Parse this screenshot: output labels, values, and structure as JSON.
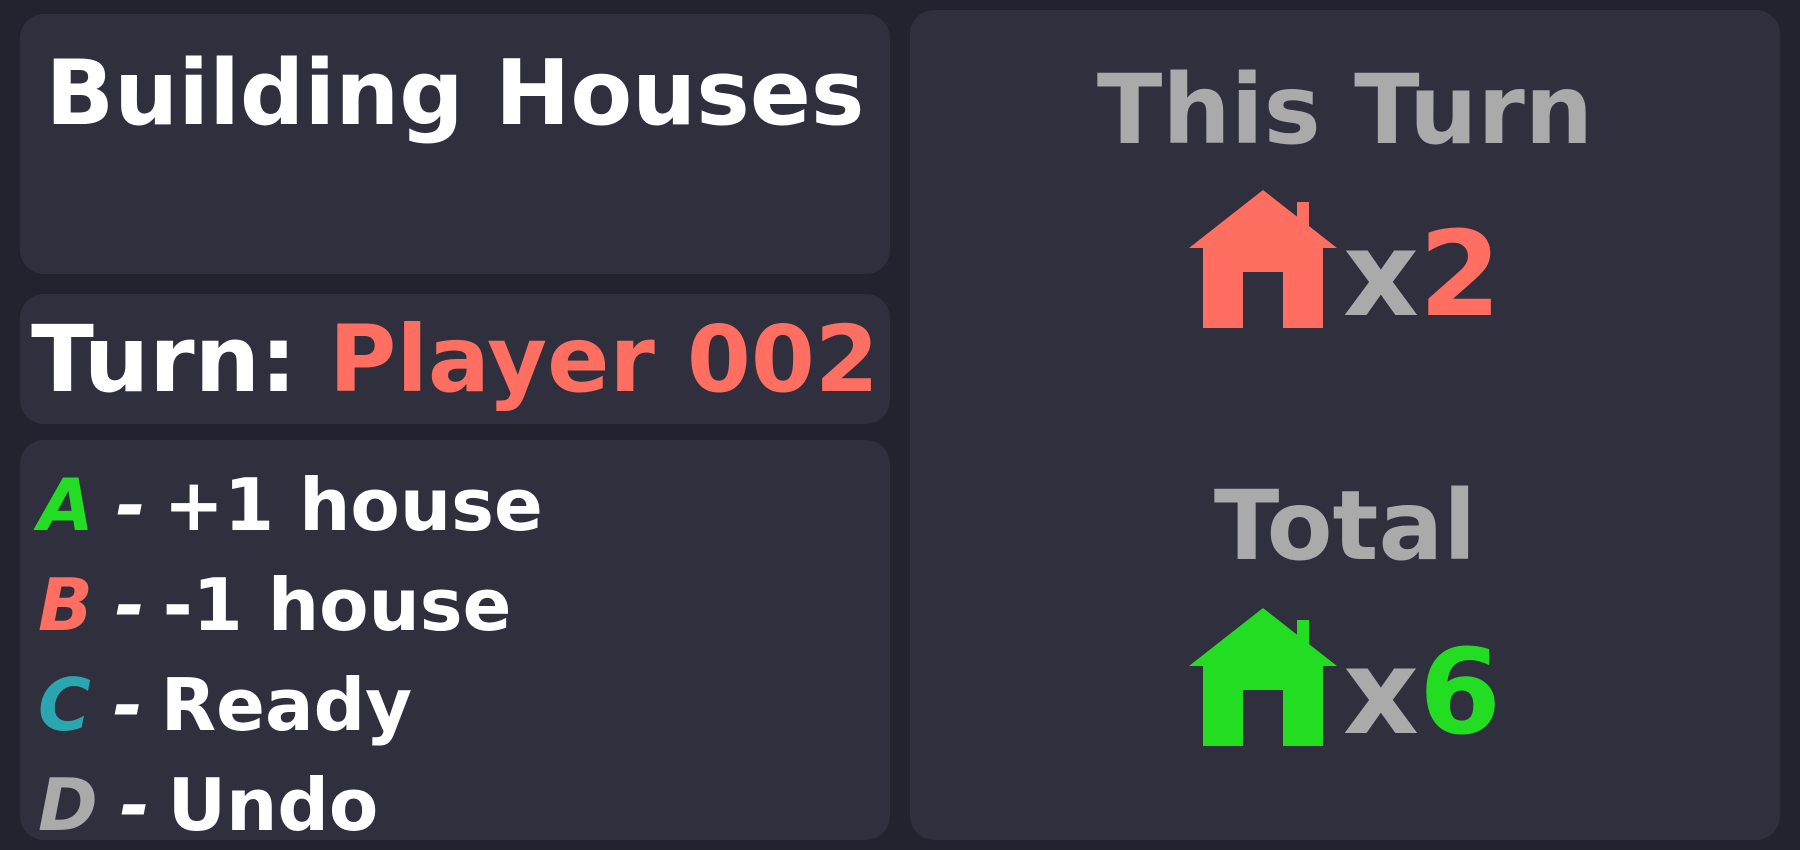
{
  "game_title": "Building Houses",
  "turn": {
    "label": "Turn:",
    "player": "Player 002",
    "player_color": "#ff6f61"
  },
  "keys": [
    {
      "key": "A",
      "sep": "-",
      "action": "+1 house",
      "color": "#22dd22"
    },
    {
      "key": "B",
      "sep": "-",
      "action": "-1 house",
      "color": "#ff6f61"
    },
    {
      "key": "C",
      "sep": "-",
      "action": "Ready",
      "color": "#2aa6b0"
    },
    {
      "key": "D",
      "sep": "-",
      "action": "Undo",
      "color": "#aaaaaa"
    }
  ],
  "this_turn": {
    "title": "This Turn",
    "icon": "house-icon",
    "x": "x",
    "count": "2",
    "color": "#ff6f61"
  },
  "total": {
    "title": "Total",
    "icon": "house-icon",
    "x": "x",
    "count": "6",
    "color": "#22dd22"
  }
}
